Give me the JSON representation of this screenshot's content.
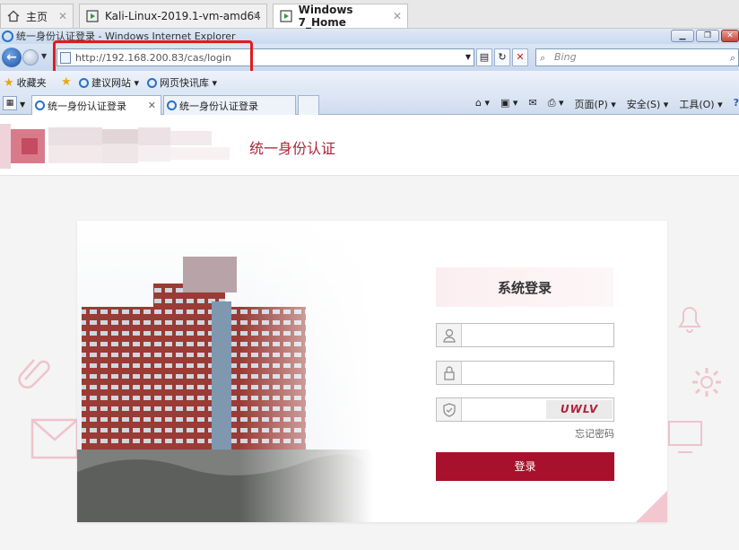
{
  "vm_tabs": [
    {
      "label": "主页",
      "icon": "home-icon"
    },
    {
      "label": "Kali-Linux-2019.1-vm-amd64",
      "icon": "vm-icon"
    },
    {
      "label": "Windows 7_Home",
      "icon": "vm-icon",
      "active": true
    }
  ],
  "ie": {
    "window_title": "统一身份认证登录 - Windows Internet Explorer",
    "address": "http://192.168.200.83/cas/login",
    "search_placeholder": "Bing",
    "favorites_label": "收藏夹",
    "fav_links": [
      "建议网站 ▾",
      "网页快讯库 ▾"
    ],
    "tabs": [
      {
        "label": "统一身份认证登录",
        "active": true
      },
      {
        "label": "统一身份认证登录",
        "active": false
      }
    ],
    "commands": [
      "页面(P) ▾",
      "安全(S) ▾",
      "工具(O) ▾"
    ]
  },
  "site": {
    "title": "统一身份认证"
  },
  "login": {
    "heading": "系统登录",
    "username_placeholder": "",
    "password_placeholder": "",
    "captcha_text": "UWLV",
    "forgot_label": "忘记密码",
    "submit_label": "登录"
  },
  "colors": {
    "brand": "#a8112b",
    "highlight": "#e21b1b"
  }
}
